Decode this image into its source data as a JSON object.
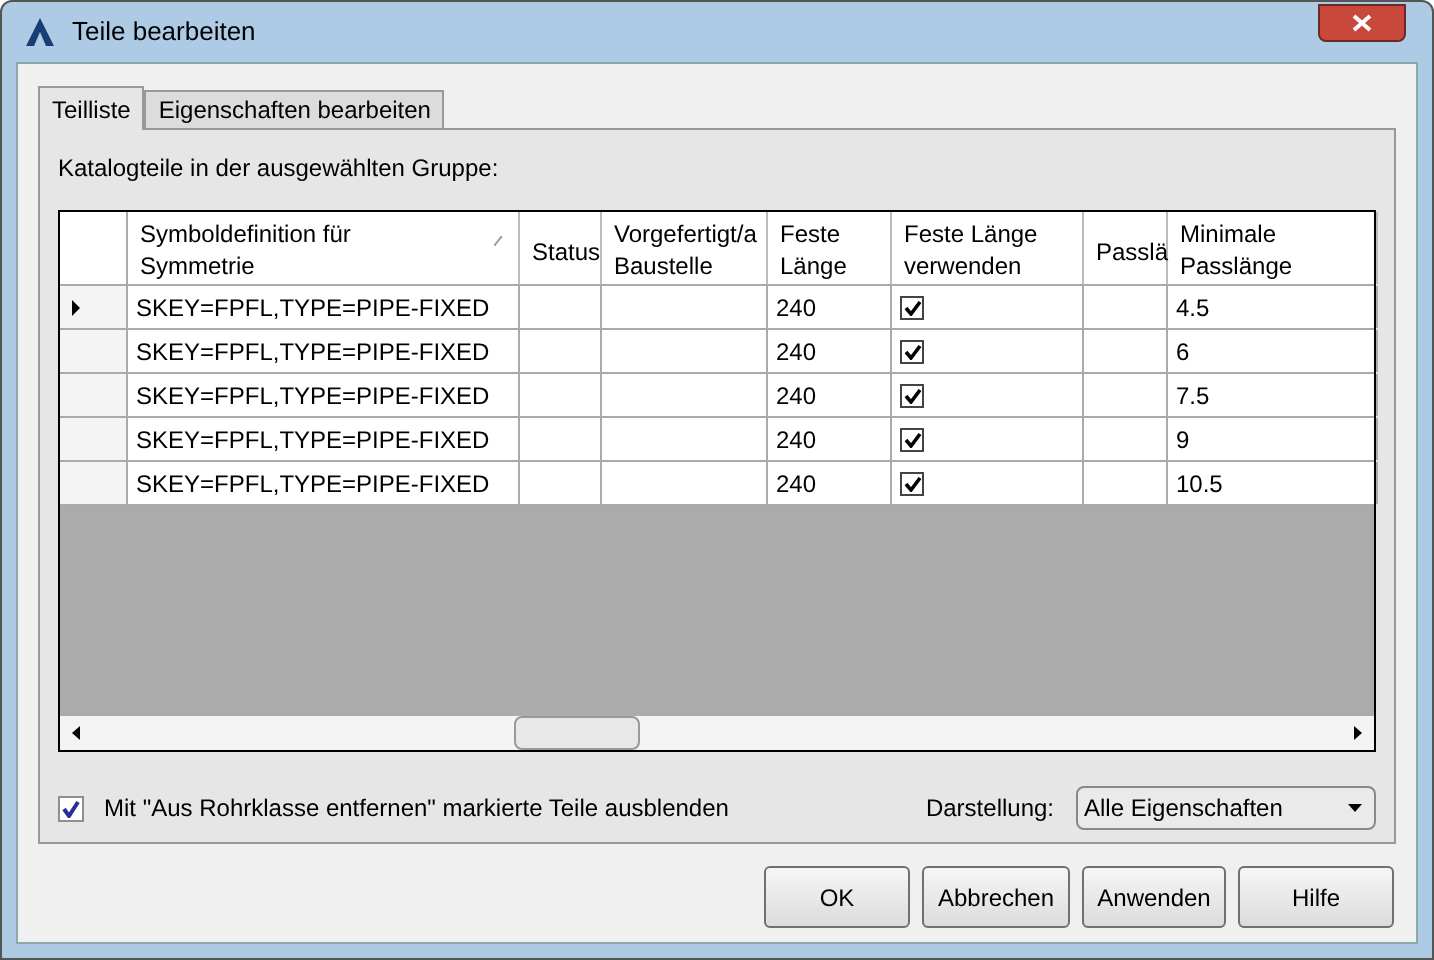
{
  "window": {
    "title": "Teile bearbeiten"
  },
  "tabs": [
    {
      "label": "Teilliste",
      "selected": true
    },
    {
      "label": "Eigenschaften bearbeiten",
      "selected": false
    }
  ],
  "caption": "Katalogteile in der ausgewählten Gruppe:",
  "table": {
    "columns": [
      {
        "label": "Symboldefinition für\nSymmetrie",
        "sortable": true
      },
      {
        "label": "Status",
        "sortable": false
      },
      {
        "label": "Vorgefertigt/a\nBaustelle",
        "sortable": false
      },
      {
        "label": "Feste\nLänge",
        "sortable": false
      },
      {
        "label": "Feste Länge\nverwenden",
        "sortable": false
      },
      {
        "label": "Passlä",
        "sortable": false
      },
      {
        "label": "Minimale\nPasslänge",
        "sortable": false
      }
    ],
    "rows": [
      {
        "current": true,
        "cells": [
          "SKEY=FPFL,TYPE=PIPE-FIXED",
          "",
          "",
          "240",
          true,
          "",
          "4.5"
        ]
      },
      {
        "current": false,
        "cells": [
          "SKEY=FPFL,TYPE=PIPE-FIXED",
          "",
          "",
          "240",
          true,
          "",
          "6"
        ]
      },
      {
        "current": false,
        "cells": [
          "SKEY=FPFL,TYPE=PIPE-FIXED",
          "",
          "",
          "240",
          true,
          "",
          "7.5"
        ]
      },
      {
        "current": false,
        "cells": [
          "SKEY=FPFL,TYPE=PIPE-FIXED",
          "",
          "",
          "240",
          true,
          "",
          "9"
        ]
      },
      {
        "current": false,
        "cells": [
          "SKEY=FPFL,TYPE=PIPE-FIXED",
          "",
          "",
          "240",
          true,
          "",
          "10.5"
        ]
      }
    ]
  },
  "hide_option": {
    "label": "Mit \"Aus Rohrklasse entfernen\" markierte Teile ausblenden",
    "checked": true
  },
  "display": {
    "label": "Darstellung:",
    "value": "Alle Eigenschaften"
  },
  "buttons": [
    "OK",
    "Abbrechen",
    "Anwenden",
    "Hilfe"
  ]
}
